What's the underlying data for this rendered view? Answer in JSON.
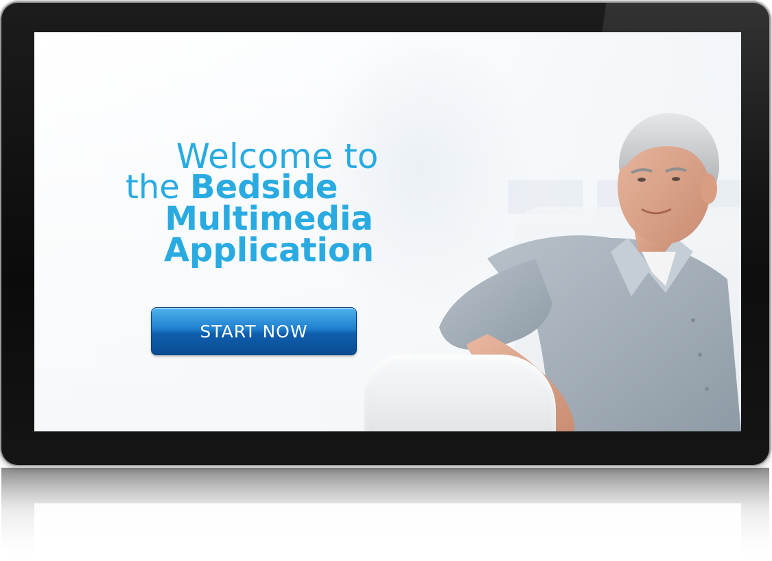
{
  "welcome": {
    "line1": "Welcome to",
    "line2_prefix": "the",
    "line2_bold": "Bedside",
    "line3": "Multimedia",
    "line4": "Application"
  },
  "actions": {
    "start_label": "START NOW"
  },
  "colors": {
    "headline": "#29abe2",
    "button_top": "#4fb3ec",
    "button_bottom": "#0a4c92",
    "bezel": "#111111"
  }
}
